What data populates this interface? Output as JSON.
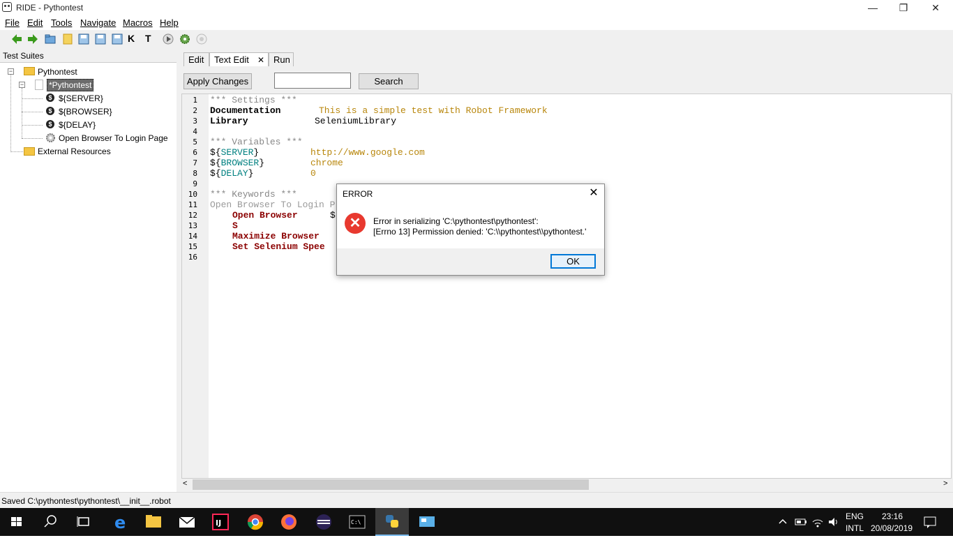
{
  "window": {
    "title": "RIDE - Pythontest",
    "controls": [
      "—",
      "❐",
      "✕"
    ]
  },
  "menu": [
    "File",
    "Edit",
    "Tools",
    "Navigate",
    "Macros",
    "Help"
  ],
  "toolbar_icons": [
    "back-arrow-icon",
    "forward-arrow-icon",
    "open-folder-icon",
    "folder-icon",
    "save-icon",
    "save-all-icon",
    "save-as-icon",
    "keyword-search-icon",
    "test-search-icon",
    "run-icon",
    "settings-gear-icon",
    "stop-icon"
  ],
  "toolbar_text_icons": {
    "k": "K",
    "t": "T"
  },
  "left": {
    "header": "Test Suites",
    "tree": {
      "root": "Pythontest",
      "suite": "*Pythontest",
      "items": [
        "${SERVER}",
        "${BROWSER}",
        "${DELAY}",
        "Open Browser To Login Page"
      ],
      "external": "External Resources"
    }
  },
  "tabs": {
    "edit": "Edit",
    "text_edit": "Text Edit",
    "run": "Run",
    "close": "✕"
  },
  "editor_toolbar": {
    "apply_label": "Apply Changes",
    "search_value": "",
    "search_label": "Search"
  },
  "editor": {
    "line_numbers": [
      "1",
      "2",
      "3",
      "4",
      "5",
      "6",
      "7",
      "8",
      "9",
      "10",
      "11",
      "12",
      "13",
      "14",
      "15",
      "16"
    ],
    "settings_header": "*** Settings ***",
    "doc_kw": "Documentation",
    "doc_val": "This is a simple test with Robot Framework",
    "lib_kw": "Library",
    "lib_val": "SeleniumLibrary",
    "variables_header": "*** Variables ***",
    "vars": [
      {
        "open": "${",
        "name": "SERVER",
        "close": "}",
        "value": "http://www.google.com"
      },
      {
        "open": "${",
        "name": "BROWSER",
        "close": "}",
        "value": "chrome"
      },
      {
        "open": "${",
        "name": "DELAY",
        "close": "}",
        "value": "0"
      }
    ],
    "keywords_header": "*** Keywords ***",
    "kw_name": "Open Browser To Login P",
    "kw_lines": [
      "Open Browser",
      "S",
      "Maximize Browser",
      "Set Selenium Spee"
    ],
    "kw_line12_tail": "$"
  },
  "status": "Saved C:\\pythontest\\pythontest\\__init__.robot",
  "dialog": {
    "title": "ERROR",
    "close": "✕",
    "line1": "Error in serializing 'C:\\pythontest\\pythontest':",
    "line2": "[Errno 13] Permission denied: 'C:\\\\pythontest\\\\pythontest.'",
    "ok_label": "OK",
    "error_glyph": "✕"
  },
  "taskbar": {
    "apps": [
      "start-icon",
      "search-icon",
      "task-view-icon",
      "edge-icon",
      "file-explorer-icon",
      "mail-icon",
      "intellij-icon",
      "chrome-icon",
      "firefox-icon",
      "eclipse-icon",
      "terminal-icon",
      "python-icon",
      "remote-desktop-icon"
    ],
    "lang_top": "ENG",
    "lang_bottom": "INTL",
    "time": "23:16",
    "date": "20/08/2019"
  },
  "colors": {
    "error_red": "#e8392f",
    "taskbar": "#101010",
    "accent_blue": "#0078d7",
    "setting_kw_red": "#8b0000"
  }
}
